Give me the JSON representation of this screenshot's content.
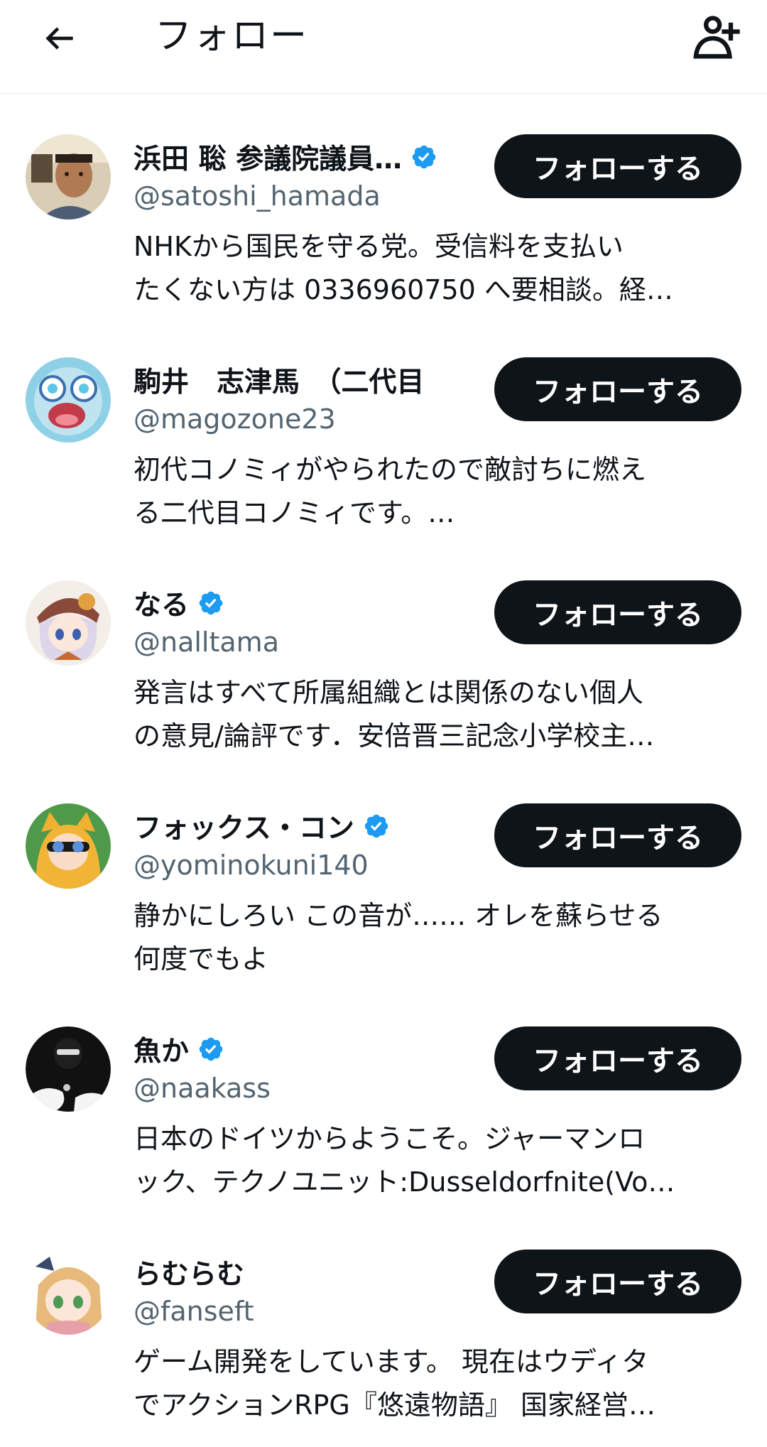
{
  "header": {
    "title": "フォロー",
    "back_icon": "arrow-left-icon",
    "add_icon": "add-user-icon"
  },
  "colors": {
    "verified": "#1d9bf0",
    "button_bg": "#0f1419",
    "handle": "#536471"
  },
  "users": [
    {
      "name": "浜田 聡 参議院議員…",
      "verified": true,
      "handle": "@satoshi_hamada",
      "bio_line1": "NHKから国民を守る党。受信料を支払い",
      "bio_line2": "たくない方は 0336960750 へ要相談。経…",
      "button": "フォローする"
    },
    {
      "name": "駒井　志津馬　（二代目",
      "verified": false,
      "handle": "@magozone23",
      "bio_line1": "初代コノミィがやられたので敵討ちに燃え",
      "bio_line2": "る二代目コノミィです。…",
      "button": "フォローする"
    },
    {
      "name": "なる",
      "verified": true,
      "handle": "@nalltama",
      "bio_line1": "発言はすべて所属組織とは関係のない個人",
      "bio_line2": "の意見/論評です．安倍晋三記念小学校主…",
      "button": "フォローする"
    },
    {
      "name": "フォックス・コン",
      "verified": true,
      "handle": "@yominokuni140",
      "bio_line1": "静かにしろい この音が…… オレを蘇らせる",
      "bio_line2": "何度でもよ",
      "button": "フォローする"
    },
    {
      "name": "魚か",
      "verified": true,
      "handle": "@naakass",
      "bio_line1": "日本のドイツからようこそ。ジャーマンロ",
      "bio_line2": "ック、テクノユニット:Dusseldorfnite(Vo…",
      "button": "フォローする"
    },
    {
      "name": "らむらむ",
      "verified": false,
      "handle": "@fanseft",
      "bio_line1": "ゲーム開発をしています。 現在はウディタ",
      "bio_line2": "でアクションRPG『悠遠物語』 国家経営…",
      "button": "フォローする"
    }
  ]
}
